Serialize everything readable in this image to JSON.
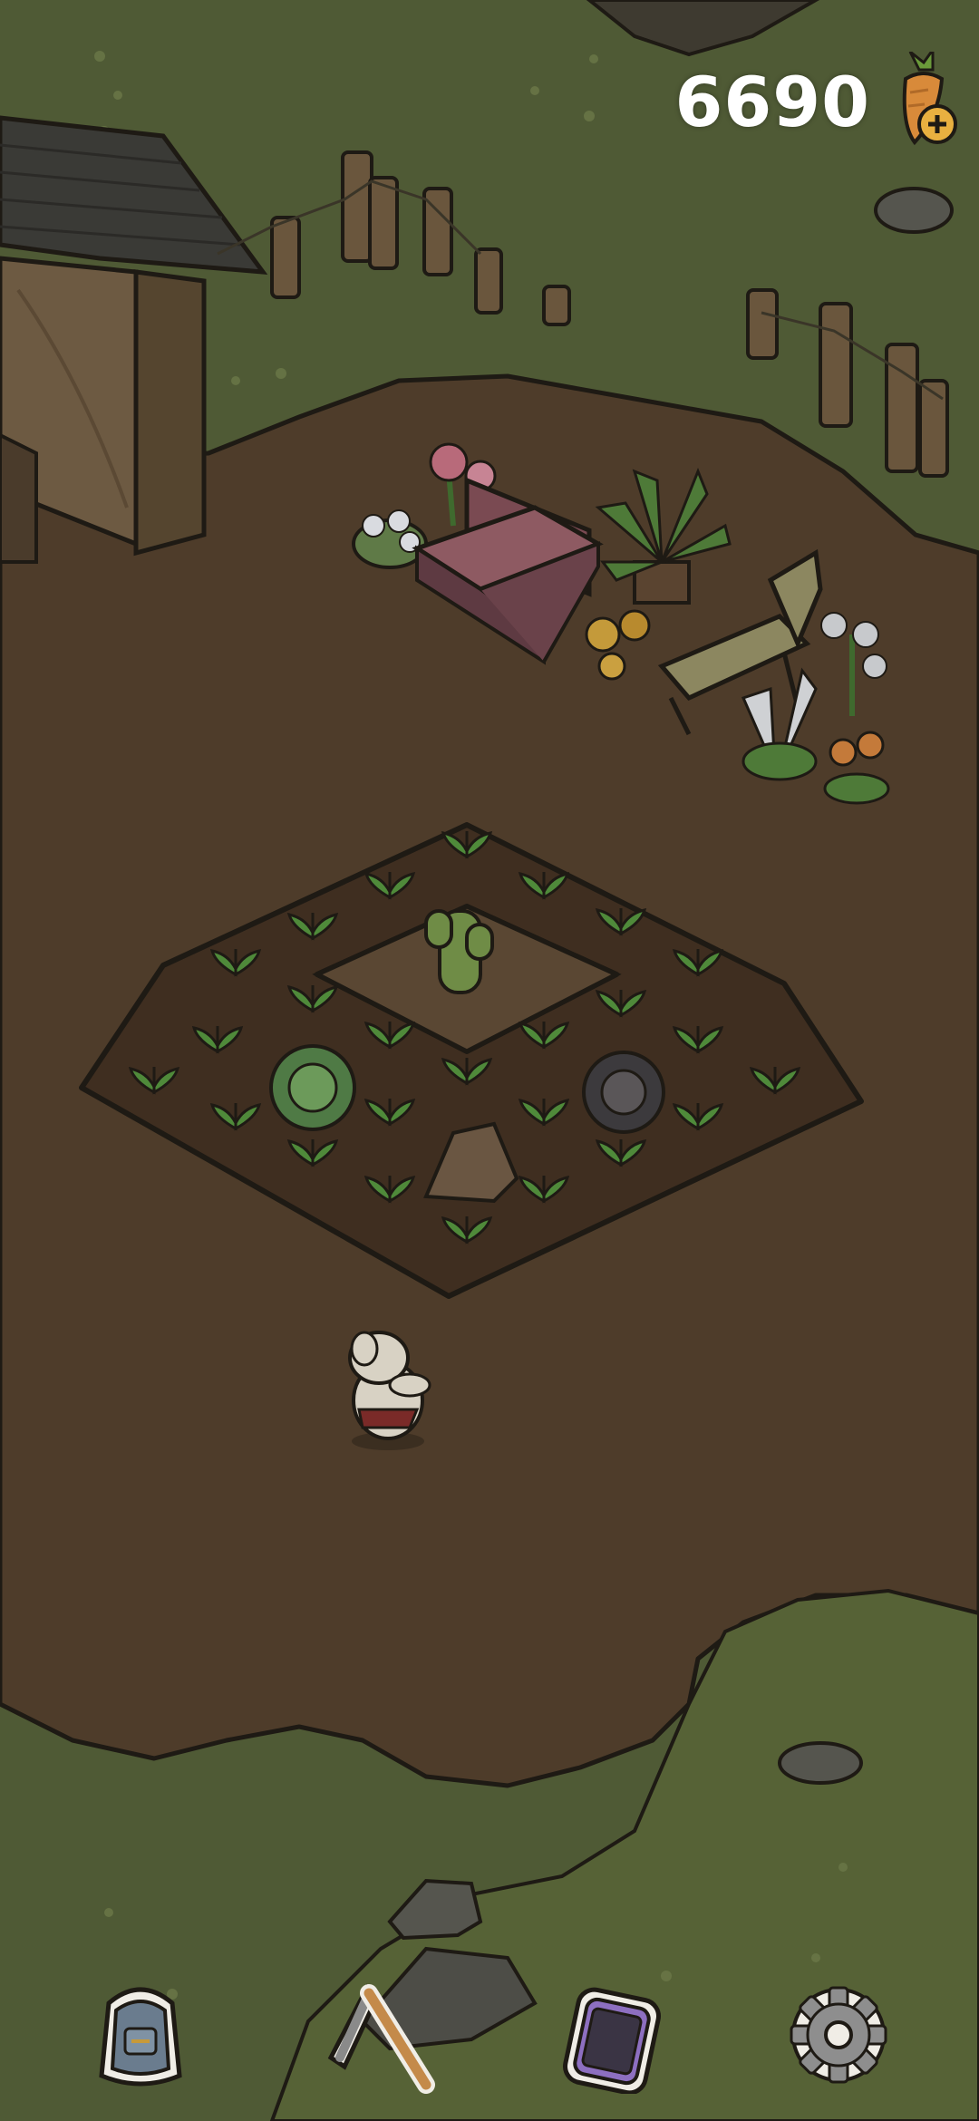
{
  "hud": {
    "carrot_count": "6690",
    "currency_icon": "carrot-plus-icon"
  },
  "toolbar": {
    "items": [
      {
        "name": "backpack",
        "icon": "backpack-icon"
      },
      {
        "name": "hoe",
        "icon": "hoe-icon"
      },
      {
        "name": "phone",
        "icon": "phone-icon"
      },
      {
        "name": "settings",
        "icon": "gear-icon"
      }
    ]
  },
  "colors": {
    "grass": "#4f5a35",
    "dirt": "#4e3c2a",
    "soil": "#3f2e20",
    "outline": "#1e1a14",
    "sprout": "#4f8a3a"
  }
}
